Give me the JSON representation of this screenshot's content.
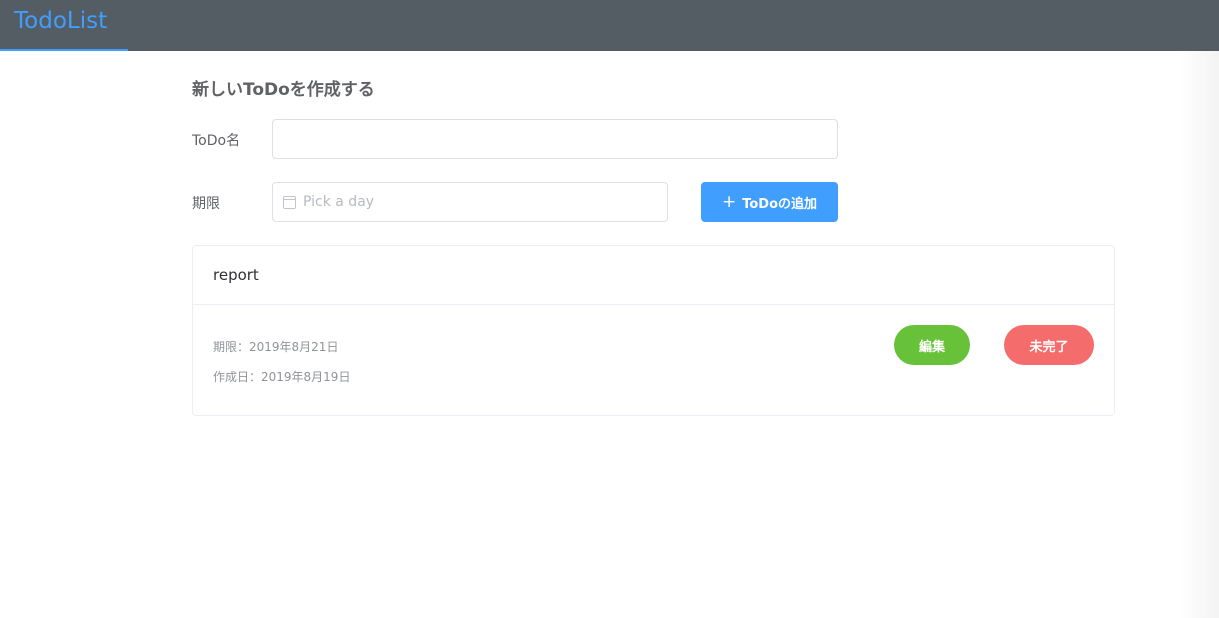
{
  "app": {
    "title": "TodoList"
  },
  "form": {
    "heading": "新しいToDoを作成する",
    "name_label": "ToDo名",
    "name_value": "",
    "deadline_label": "期限",
    "deadline_placeholder": "Pick a day",
    "add_button_label": "ToDoの追加",
    "add_button_icon": "plus-icon"
  },
  "todos": [
    {
      "title": "report",
      "deadline_text": "期限：2019年8月21日",
      "created_text": "作成日：2019年8月19日",
      "edit_label": "編集",
      "status_label": "未完了"
    }
  ],
  "colors": {
    "nav_bg": "#545c64",
    "accent": "#409eff",
    "edit": "#67c23a",
    "incomplete": "#f56c6c"
  }
}
